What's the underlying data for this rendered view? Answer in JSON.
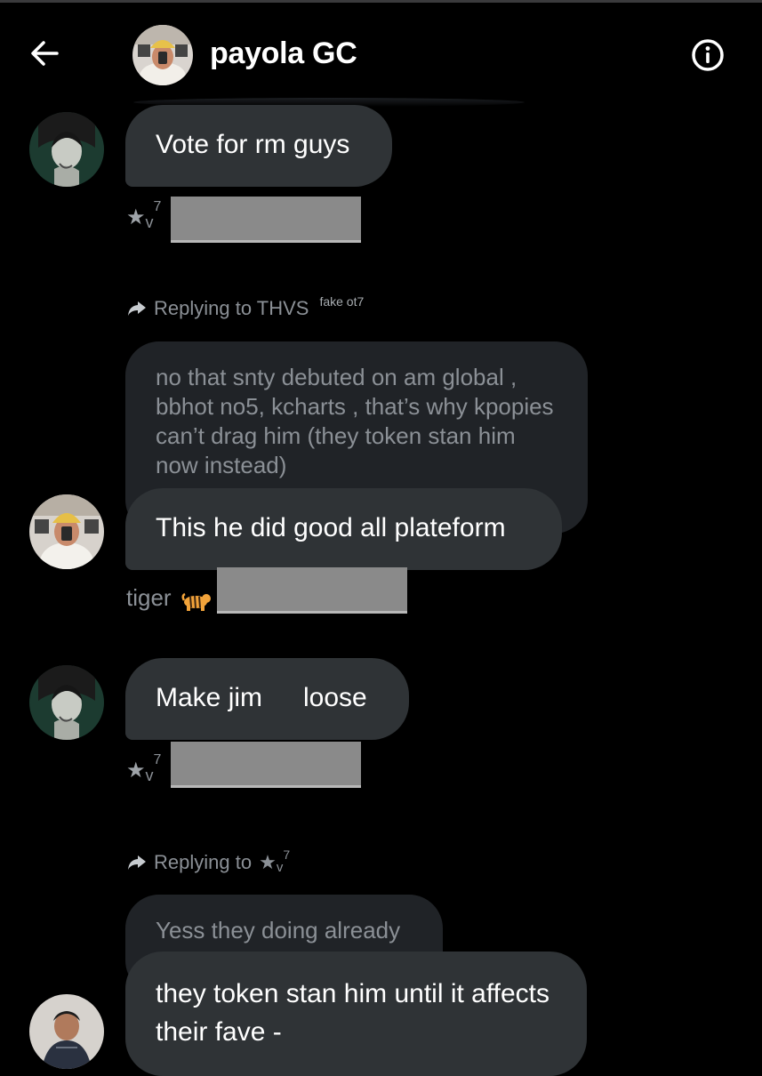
{
  "header": {
    "title": "payola GC"
  },
  "icons": {
    "back": "arrow-left-icon",
    "info": "info-circle-icon",
    "reply": "reply-arrow-icon",
    "tiger": "tiger-emoji-icon"
  },
  "messages": [
    {
      "text": "Vote for rm guys",
      "sender_star": "★",
      "sender_v": "v",
      "sender_sup": "7"
    },
    {
      "reply_prefix": "Replying to THVS",
      "reply_tag": "fake ot7",
      "quoted": "no that snty debuted on am global , bbhot no5, kcharts , that’s why kpopies can’t drag him (they token stan him now instead)",
      "text": "This he did good all plateform",
      "sender_name": "tiger"
    },
    {
      "text_a": "Make jim",
      "text_b": "loose",
      "sender_star": "★",
      "sender_v": "v",
      "sender_sup": "7"
    },
    {
      "reply_prefix": "Replying to",
      "reply_star": "★",
      "reply_v": "v",
      "reply_sup": "7",
      "quoted": "Yess they doing already",
      "text": "they token stan him until it affects their fave -"
    }
  ],
  "colors": {
    "background": "#000000",
    "bubble": "#2f3336",
    "quoted_bubble": "#202327",
    "secondary_text": "#8b9096",
    "redaction": "#8a8a8a"
  }
}
